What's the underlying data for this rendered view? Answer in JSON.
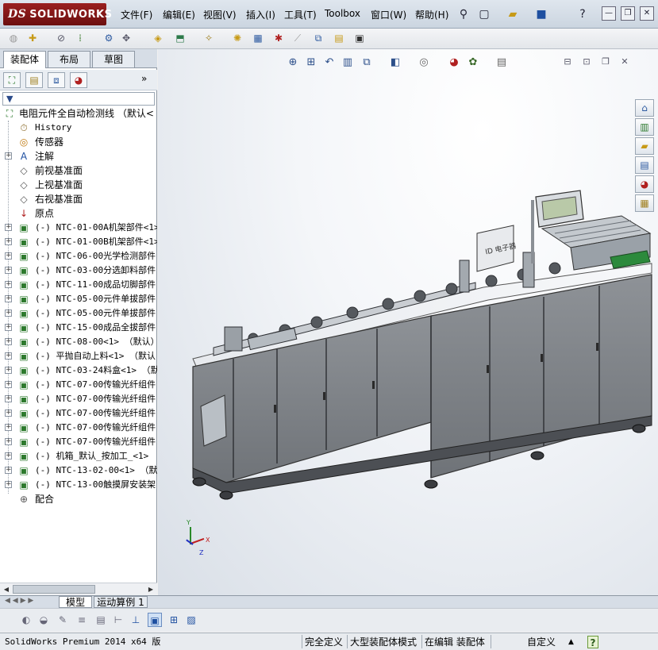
{
  "app": {
    "logo_ds": "DS",
    "logo_text": "SOLIDWORKS"
  },
  "menu": [
    "文件(F)",
    "编辑(E)",
    "视图(V)",
    "插入(I)",
    "工具(T)",
    "Toolbox",
    "窗口(W)",
    "帮助(H)"
  ],
  "left_tabs": [
    "装配体",
    "布局",
    "草图"
  ],
  "tree": {
    "root": "电阻元件全自动检测线 （默认<",
    "items": [
      {
        "icon": "history-icon",
        "glyph": "⏱",
        "label": "History",
        "mono": true
      },
      {
        "icon": "sensor-icon",
        "glyph": "◎",
        "label": "传感器"
      },
      {
        "icon": "annotation-icon",
        "glyph": "A",
        "label": "注解",
        "expand": "+"
      },
      {
        "icon": "plane-icon",
        "glyph": "◇",
        "label": "前视基准面"
      },
      {
        "icon": "plane-icon",
        "glyph": "◇",
        "label": "上视基准面"
      },
      {
        "icon": "plane-icon",
        "glyph": "◇",
        "label": "右视基准面"
      },
      {
        "icon": "origin-icon",
        "glyph": "↓",
        "label": "原点"
      },
      {
        "icon": "subassembly-icon",
        "glyph": "▣",
        "label": "(-) NTC-01-00A机架部件<1>",
        "expand": "+",
        "mono": true
      },
      {
        "icon": "subassembly-icon",
        "glyph": "▣",
        "label": "(-) NTC-01-00B机架部件<1>",
        "expand": "+",
        "mono": true
      },
      {
        "icon": "subassembly-icon",
        "glyph": "▣",
        "label": "(-) NTC-06-00光学检测部件",
        "expand": "+",
        "mono": true
      },
      {
        "icon": "subassembly-icon",
        "glyph": "▣",
        "label": "(-) NTC-03-00分选卸料部件",
        "expand": "+",
        "mono": true
      },
      {
        "icon": "subassembly-icon",
        "glyph": "▣",
        "label": "(-) NTC-11-00成品切脚部件",
        "expand": "+",
        "mono": true
      },
      {
        "icon": "subassembly-icon",
        "glyph": "▣",
        "label": "(-) NTC-05-00元件单拔部件",
        "expand": "+",
        "mono": true
      },
      {
        "icon": "subassembly-icon",
        "glyph": "▣",
        "label": "(-) NTC-05-00元件单拔部件",
        "expand": "+",
        "mono": true
      },
      {
        "icon": "subassembly-icon",
        "glyph": "▣",
        "label": "(-) NTC-15-00成品全拔部件",
        "expand": "+",
        "mono": true
      },
      {
        "icon": "subassembly-icon",
        "glyph": "▣",
        "label": "(-) NTC-08-00<1> （默认）",
        "expand": "+",
        "mono": true
      },
      {
        "icon": "subassembly-icon",
        "glyph": "▣",
        "label": "(-) 平抛自动上料<1> （默认",
        "expand": "+",
        "mono": true
      },
      {
        "icon": "subassembly-icon",
        "glyph": "▣",
        "label": "(-) NTC-03-24料盒<1> （默认",
        "expand": "+",
        "mono": true
      },
      {
        "icon": "subassembly-icon",
        "glyph": "▣",
        "label": "(-) NTC-07-00传输光纤组件",
        "expand": "+",
        "mono": true
      },
      {
        "icon": "subassembly-icon",
        "glyph": "▣",
        "label": "(-) NTC-07-00传输光纤组件",
        "expand": "+",
        "mono": true
      },
      {
        "icon": "subassembly-icon",
        "glyph": "▣",
        "label": "(-) NTC-07-00传输光纤组件",
        "expand": "+",
        "mono": true
      },
      {
        "icon": "subassembly-icon",
        "glyph": "▣",
        "label": "(-) NTC-07-00传输光纤组件",
        "expand": "+",
        "mono": true
      },
      {
        "icon": "subassembly-icon",
        "glyph": "▣",
        "label": "(-) NTC-07-00传输光纤组件",
        "expand": "+",
        "mono": true
      },
      {
        "icon": "subassembly-icon",
        "glyph": "▣",
        "label": "(-) 机箱_默认_按加工_<1>",
        "expand": "+",
        "mono": true
      },
      {
        "icon": "subassembly-icon",
        "glyph": "▣",
        "label": "(-) NTC-13-02-00<1> （默认",
        "expand": "+",
        "mono": true
      },
      {
        "icon": "subassembly-icon",
        "glyph": "▣",
        "label": "(-) NTC-13-00触摸屏安装架",
        "expand": "+",
        "mono": true
      },
      {
        "icon": "mates-icon",
        "glyph": "⊕",
        "label": "配合"
      }
    ]
  },
  "model_tabs": [
    "模型",
    "运动算例 1"
  ],
  "status": {
    "left": "SolidWorks Premium 2014 x64 版",
    "fully_defined": "完全定义",
    "large_assembly": "大型装配体模式",
    "editing": "在编辑 装配体",
    "custom": "自定义",
    "help": "?"
  },
  "screen_label": "ID 电子器",
  "axes": {
    "y": "Y",
    "x": "X",
    "z": "Z"
  }
}
